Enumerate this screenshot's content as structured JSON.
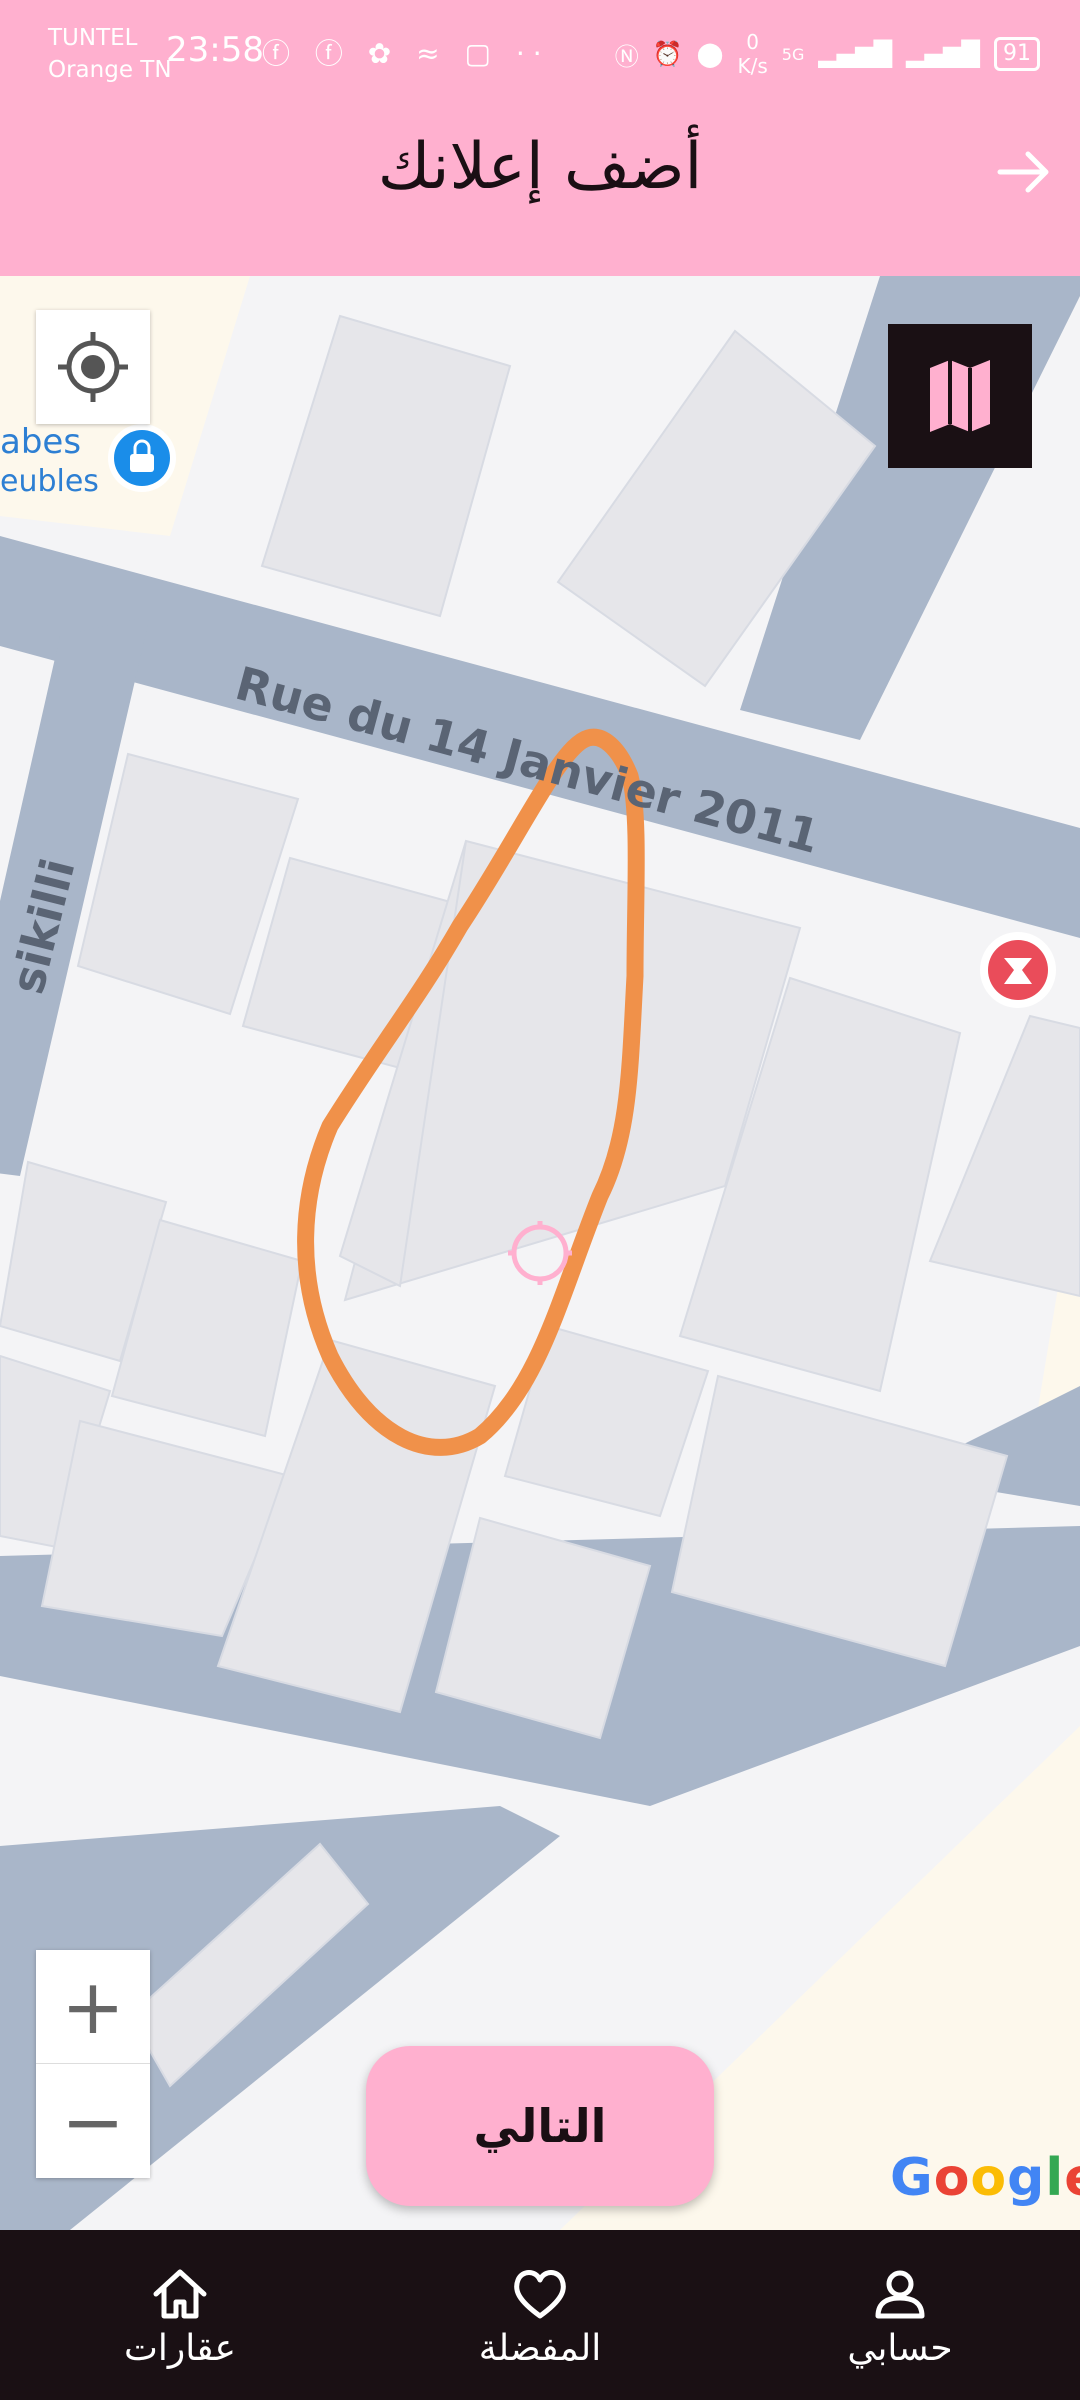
{
  "status_bar": {
    "carrier_line1": "TUNTEL",
    "carrier_line2": "Orange TN",
    "time": "23:58",
    "icons_left": "ⓕ ⓕ ✿ ≈ ▢ ··",
    "net_speed_value": "0",
    "net_speed_unit": "K/s",
    "signal_label": "5G",
    "battery": "91"
  },
  "header": {
    "title": "أضف إعلانك",
    "back_icon": "arrow-right-icon"
  },
  "map": {
    "poi_label_line1": "abes",
    "poi_label_line2": "eubles",
    "road_label_main": "Rue du 14 Janvier 2011",
    "road_label_side": "sikilli",
    "zoom_in": "+",
    "zoom_out": "−",
    "logo": [
      "G",
      "o",
      "o",
      "g",
      "l",
      "e"
    ],
    "logo_colors": [
      "#4285f4",
      "#ea4335",
      "#fbbc05",
      "#4285f4",
      "#34a853",
      "#ea4335"
    ],
    "drawn_outline_color": "#f0914a",
    "marker_color": "#ffb0cf"
  },
  "actions": {
    "next_label": "التالي"
  },
  "bottom_nav": {
    "items": [
      {
        "label": "عقارات",
        "icon": "home-icon"
      },
      {
        "label": "المفضلة",
        "icon": "heart-icon"
      },
      {
        "label": "حسابي",
        "icon": "user-icon"
      }
    ]
  },
  "colors": {
    "accent": "#ffb0cf",
    "nav_background": "#1a1014",
    "road": "#a9b6c9",
    "building": "#e6e6ea"
  }
}
